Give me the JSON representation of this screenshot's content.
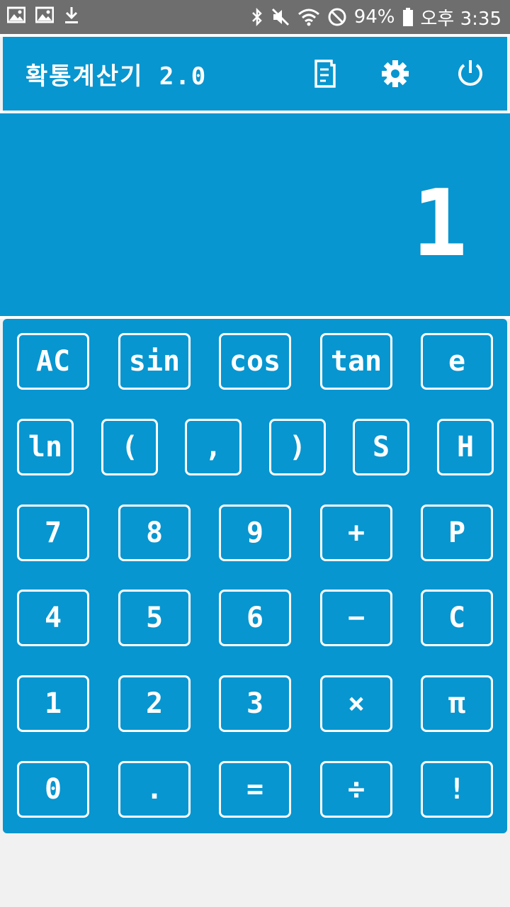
{
  "status_bar": {
    "battery": "94%",
    "time": "오후 3:35",
    "left_icons": [
      "image-icon",
      "image-icon",
      "download-icon"
    ],
    "right_icons": [
      "bluetooth-icon",
      "mute-icon",
      "wifi-icon",
      "block-icon",
      "battery-icon"
    ]
  },
  "app": {
    "title": "확통계산기 2.0",
    "header_icons": [
      "history-icon",
      "gear-icon",
      "power-icon"
    ],
    "accent_color": "#0796d0"
  },
  "display": {
    "value": "1"
  },
  "keypad": {
    "rows": [
      [
        "AC",
        "sin",
        "cos",
        "tan",
        "e"
      ],
      [
        "ln",
        "(",
        ",",
        ")",
        "S",
        "H"
      ],
      [
        "7",
        "8",
        "9",
        "+",
        "P"
      ],
      [
        "4",
        "5",
        "6",
        "−",
        "C"
      ],
      [
        "1",
        "2",
        "3",
        "×",
        "π"
      ],
      [
        "0",
        ".",
        "=",
        "÷",
        "!"
      ]
    ]
  }
}
